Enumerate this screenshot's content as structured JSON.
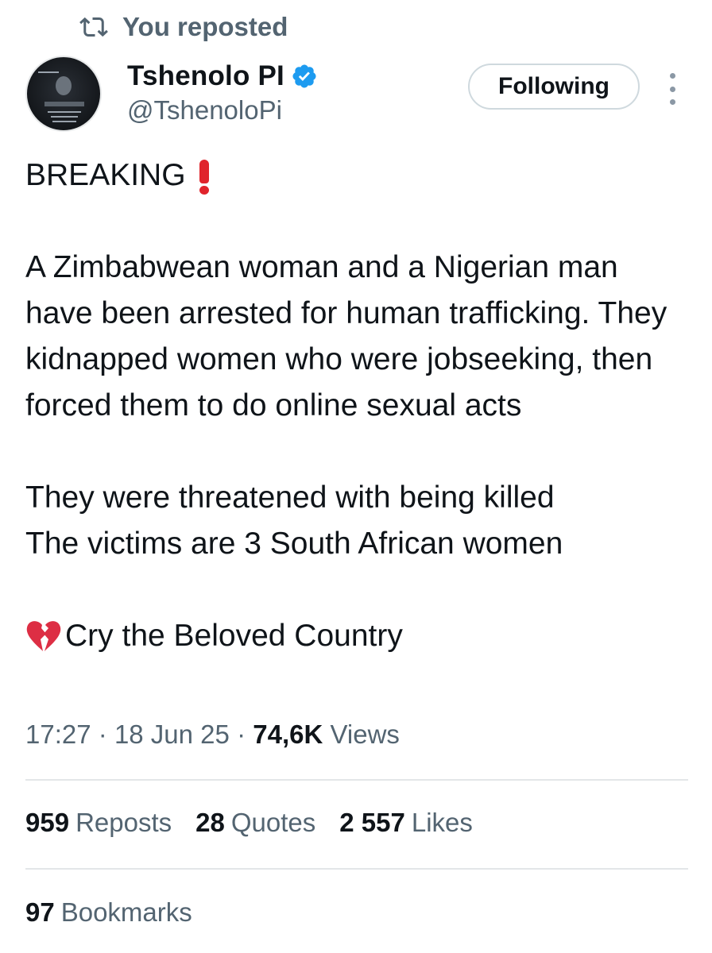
{
  "repost_banner": {
    "text": "You reposted",
    "icon": "repost-icon"
  },
  "author": {
    "display_name": "Tshenolo PI",
    "handle": "@TshenoloPi",
    "verified": true,
    "verified_color": "#1d9bf0"
  },
  "follow_button": {
    "label": "Following"
  },
  "more_menu": {
    "icon": "more-vertical-icon"
  },
  "tweet": {
    "headline": "BREAKING",
    "headline_emoji": "red-exclamation-icon",
    "paragraph_1": "A Zimbabwean woman and a Nigerian man have been arrested for human trafficking. They kidnapped women who were jobseeking, then forced them to do online sexual acts",
    "paragraph_2_line_1": "They were threatened with being killed",
    "paragraph_2_line_2": "The victims are 3 South African women",
    "closing_emoji": "broken-heart-icon",
    "closing_text": "Cry the Beloved Country"
  },
  "meta": {
    "time": "17:27",
    "separator": "·",
    "date": "18 Jun 25",
    "views_count": "74,6K",
    "views_label": "Views"
  },
  "stats": {
    "reposts": {
      "count": "959",
      "label": "Reposts"
    },
    "quotes": {
      "count": "28",
      "label": "Quotes"
    },
    "likes": {
      "count": "2 557",
      "label": "Likes"
    },
    "bookmarks": {
      "count": "97",
      "label": "Bookmarks"
    }
  },
  "colors": {
    "text_primary": "#0f1419",
    "text_secondary": "#536471",
    "accent_red": "#e0242c",
    "divider": "#e3e6e8"
  }
}
